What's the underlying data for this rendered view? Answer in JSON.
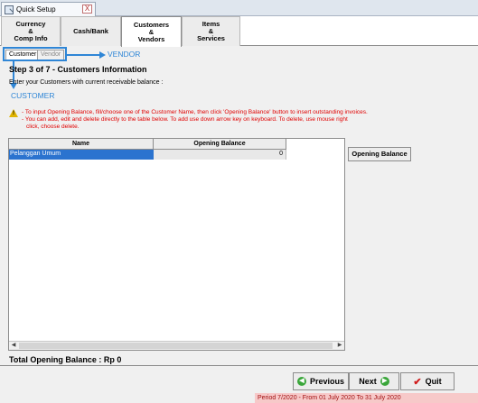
{
  "window": {
    "tab_title": "Quick Setup",
    "close_label": "X"
  },
  "category_tabs": [
    {
      "label": "Currency\n&\nComp Info"
    },
    {
      "label": "Cash/Bank"
    },
    {
      "label": "Customers\n&\nVendors"
    },
    {
      "label": "Items\n&\nServices"
    }
  ],
  "sub_tabs": [
    {
      "label": "Customer"
    },
    {
      "label": "Vendor"
    }
  ],
  "annotations": {
    "vendor": "VENDOR",
    "customer": "CUSTOMER"
  },
  "step": {
    "title": "Step 3 of 7   - Customers Information",
    "subtitle": "Enter your Customers with current receivable balance :"
  },
  "info": {
    "line1": "- To input Opening Balance, fill/choose one of the Customer Name, then click 'Opening Balance' button to insert outstanding invoices.",
    "line2": "- You can add, edit and delete directly to the table below. To add use down arrow key on keyboard. To delete, use mouse right",
    "line3": "click, choose delete."
  },
  "grid": {
    "columns": [
      "Name",
      "Opening Balance"
    ],
    "rows": [
      {
        "name": "Pelanggan Umum",
        "opening_balance": "0"
      }
    ]
  },
  "opening_balance_button": "Opening Balance",
  "total": "Total Opening Balance : Rp 0",
  "buttons": {
    "previous": "Previous",
    "next": "Next",
    "quit": "Quit"
  },
  "status_bar": "Period 7/2020 - From 01 July 2020 To 31 July 2020"
}
